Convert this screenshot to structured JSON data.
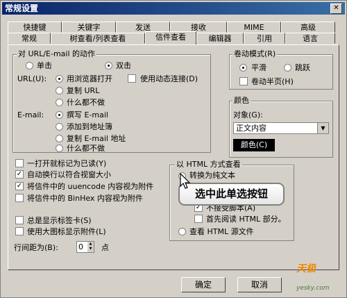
{
  "window": {
    "title": "常规设置"
  },
  "tabs_row1": [
    "快捷键",
    "关键字",
    "发送",
    "接收",
    "MIME",
    "高级"
  ],
  "tabs_row2": [
    "常规",
    "树查看/列表查看",
    "信件查看",
    "编辑器",
    "引用",
    "语言"
  ],
  "action_group": {
    "title": "对 URL/E-mail 的动作",
    "click_single": "单击",
    "click_double": "双击",
    "url_label": "URL(U):",
    "url_options": [
      "用浏览器打开",
      "复制 URL",
      "什么都不做"
    ],
    "dynamic_connect": "使用动态连接(D)",
    "email_label": "E-mail:",
    "email_options": [
      "撰写 E-mail",
      "添加到地址簿",
      "复制 E-mail 地址",
      "什么都不做"
    ]
  },
  "scroll_group": {
    "title": "卷动模式(R)",
    "smooth": "平滑",
    "jump": "跳跃",
    "half_page": "卷动半页(H)"
  },
  "color_group": {
    "title": "颜色",
    "object_label": "对象(G):",
    "object_value": "正文内容",
    "color_button": "颜色(C)"
  },
  "options": [
    "一打开就标记为已读(Y)",
    "自动换行以符合视窗大小",
    "将信件中的 uuencode 内容视为附件",
    "将信件中的 BinHex 内容视为附件",
    "总是显示标签卡(S)",
    "使用大图标显示附件(L)"
  ],
  "line_spacing": {
    "label": "行间距为(B):",
    "value": "0",
    "unit": "点"
  },
  "html_group": {
    "title": "以 HTML 方式查看",
    "convert_text": "转换为纯文本",
    "no_script": "不接受脚本(A)",
    "first_read_html": "首先阅读 HTML 部分。",
    "view_source": "查看 HTML 源文件"
  },
  "callout": "选中此单选按钮",
  "buttons": {
    "ok": "确定",
    "cancel": "取消"
  },
  "watermark": {
    "logo": "天极",
    "site": "yesky.com"
  }
}
